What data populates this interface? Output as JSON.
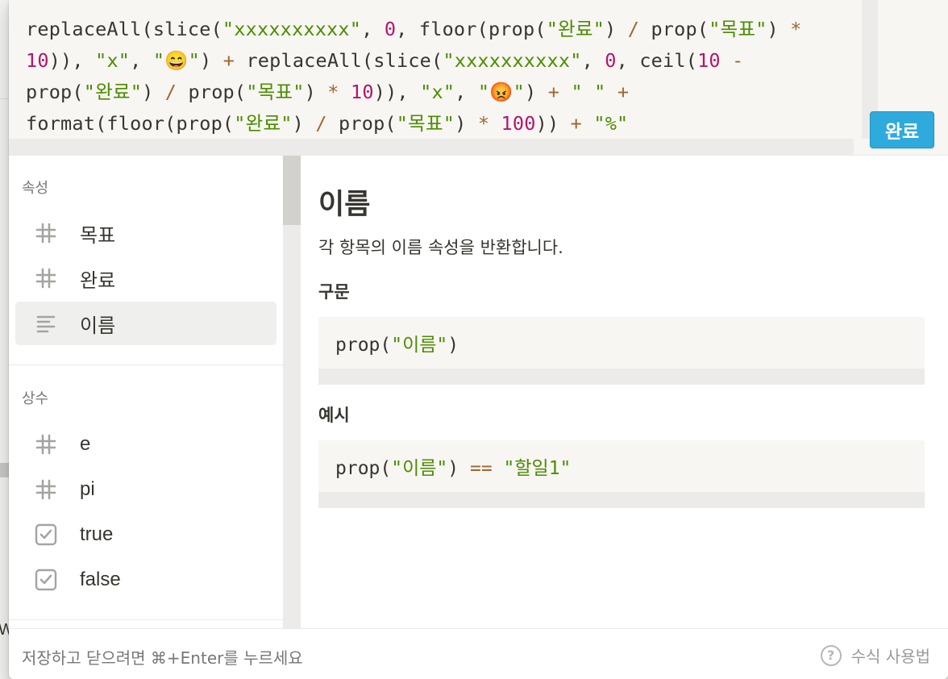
{
  "editor": {
    "formula": [
      {
        "t": "fn",
        "v": "replaceAll(slice("
      },
      {
        "t": "str",
        "v": "\"xxxxxxxxxx\""
      },
      {
        "t": "fn",
        "v": ", "
      },
      {
        "t": "num",
        "v": "0"
      },
      {
        "t": "fn",
        "v": ", floor(prop("
      },
      {
        "t": "str",
        "v": "\"완료\""
      },
      {
        "t": "fn",
        "v": ") "
      },
      {
        "t": "op",
        "v": "/"
      },
      {
        "t": "fn",
        "v": " prop("
      },
      {
        "t": "str",
        "v": "\"목표\""
      },
      {
        "t": "fn",
        "v": ") "
      },
      {
        "t": "op",
        "v": "*"
      },
      {
        "t": "fn",
        "v": " "
      },
      {
        "t": "num",
        "v": "10"
      },
      {
        "t": "fn",
        "v": ")), "
      },
      {
        "t": "str",
        "v": "\"x\""
      },
      {
        "t": "fn",
        "v": ", "
      },
      {
        "t": "str",
        "v": "\"😄\""
      },
      {
        "t": "fn",
        "v": ") "
      },
      {
        "t": "op",
        "v": "+"
      },
      {
        "t": "fn",
        "v": " replaceAll(slice("
      },
      {
        "t": "str",
        "v": "\"xxxxxxxxxx\""
      },
      {
        "t": "fn",
        "v": ", "
      },
      {
        "t": "num",
        "v": "0"
      },
      {
        "t": "fn",
        "v": ", ceil("
      },
      {
        "t": "num",
        "v": "10"
      },
      {
        "t": "fn",
        "v": " "
      },
      {
        "t": "op",
        "v": "-"
      },
      {
        "t": "fn",
        "v": "\nprop("
      },
      {
        "t": "str",
        "v": "\"완료\""
      },
      {
        "t": "fn",
        "v": ") "
      },
      {
        "t": "op",
        "v": "/"
      },
      {
        "t": "fn",
        "v": " prop("
      },
      {
        "t": "str",
        "v": "\"목표\""
      },
      {
        "t": "fn",
        "v": ") "
      },
      {
        "t": "op",
        "v": "*"
      },
      {
        "t": "fn",
        "v": " "
      },
      {
        "t": "num",
        "v": "10"
      },
      {
        "t": "fn",
        "v": ")), "
      },
      {
        "t": "str",
        "v": "\"x\""
      },
      {
        "t": "fn",
        "v": ", "
      },
      {
        "t": "str",
        "v": "\"😡\""
      },
      {
        "t": "fn",
        "v": ") "
      },
      {
        "t": "op",
        "v": "+"
      },
      {
        "t": "fn",
        "v": " "
      },
      {
        "t": "str",
        "v": "\" \""
      },
      {
        "t": "fn",
        "v": " "
      },
      {
        "t": "op",
        "v": "+"
      },
      {
        "t": "fn",
        "v": "\nformat(floor(prop("
      },
      {
        "t": "str",
        "v": "\"완료\""
      },
      {
        "t": "fn",
        "v": ") "
      },
      {
        "t": "op",
        "v": "/"
      },
      {
        "t": "fn",
        "v": " prop("
      },
      {
        "t": "str",
        "v": "\"목표\""
      },
      {
        "t": "fn",
        "v": ") "
      },
      {
        "t": "op",
        "v": "*"
      },
      {
        "t": "fn",
        "v": " "
      },
      {
        "t": "num",
        "v": "100"
      },
      {
        "t": "fn",
        "v": ")) "
      },
      {
        "t": "op",
        "v": "+"
      },
      {
        "t": "fn",
        "v": " "
      },
      {
        "t": "str",
        "v": "\"%\""
      }
    ],
    "done_label": "완료"
  },
  "sidebar": {
    "properties_title": "속성",
    "properties": [
      {
        "label": "목표",
        "icon": "number-icon",
        "selected": false
      },
      {
        "label": "완료",
        "icon": "number-icon",
        "selected": false
      },
      {
        "label": "이름",
        "icon": "text-lines-icon",
        "selected": true
      }
    ],
    "constants_title": "상수",
    "constants": [
      {
        "label": "e",
        "icon": "number-icon"
      },
      {
        "label": "pi",
        "icon": "number-icon"
      },
      {
        "label": "true",
        "icon": "checkbox-icon"
      },
      {
        "label": "false",
        "icon": "checkbox-icon"
      }
    ]
  },
  "detail": {
    "title": "이름",
    "description": "각 항목의 이름 속성을 반환합니다.",
    "syntax_heading": "구문",
    "syntax_code": [
      {
        "t": "fn",
        "v": "prop("
      },
      {
        "t": "str",
        "v": "\"이름\""
      },
      {
        "t": "fn",
        "v": ")"
      }
    ],
    "example_heading": "예시",
    "example_code": [
      {
        "t": "fn",
        "v": "prop("
      },
      {
        "t": "str",
        "v": "\"이름\""
      },
      {
        "t": "fn",
        "v": ") "
      },
      {
        "t": "op",
        "v": "=="
      },
      {
        "t": "fn",
        "v": " "
      },
      {
        "t": "str",
        "v": "\"할일1\""
      }
    ]
  },
  "footer": {
    "hint": "저장하고 닫으려면 ⌘+Enter를 누르세요",
    "help_label": "수식 사용법"
  },
  "background": {
    "fragment_left": "W"
  },
  "colors": {
    "accent": "#2eaadc",
    "string": "#4d8c00",
    "number": "#b5166b",
    "operator": "#a2662f"
  }
}
